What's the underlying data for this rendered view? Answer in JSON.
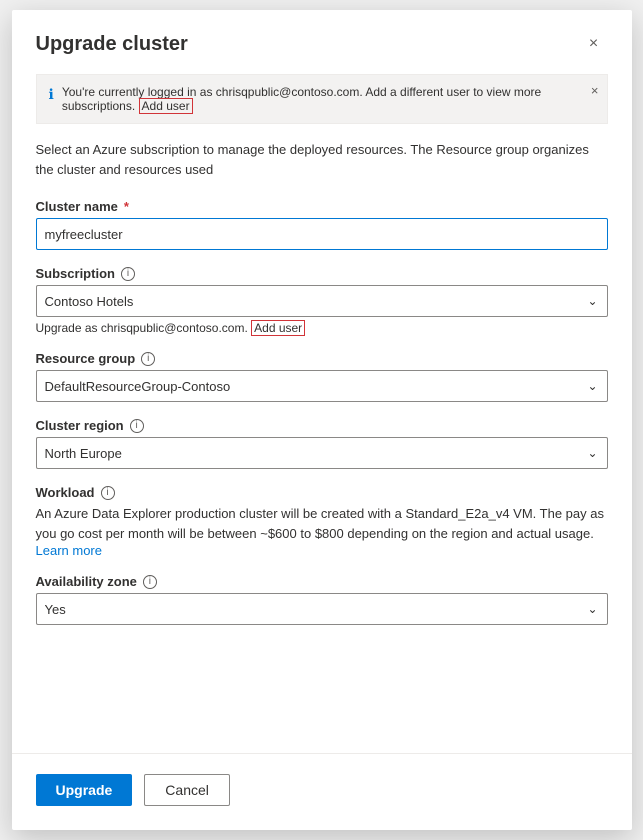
{
  "dialog": {
    "title": "Upgrade cluster",
    "close_label": "×"
  },
  "banner": {
    "text_before": "You're currently logged in as chrisqpublic@contoso.com. Add a different user to view more subscriptions.",
    "add_user_label": "Add user",
    "close_label": "×"
  },
  "description": "Select an Azure subscription to manage the deployed resources. The Resource group organizes the cluster and resources used",
  "form": {
    "cluster_name": {
      "label": "Cluster name",
      "required": "*",
      "value": "myfreecluster",
      "placeholder": ""
    },
    "subscription": {
      "label": "Subscription",
      "value": "Contoso Hotels",
      "note_before": "Upgrade as chrisqpublic@contoso.com.",
      "add_user_label": "Add user"
    },
    "resource_group": {
      "label": "Resource group",
      "value": "DefaultResourceGroup-Contoso"
    },
    "cluster_region": {
      "label": "Cluster region",
      "value": "North Europe"
    },
    "workload": {
      "label": "Workload",
      "description": "An Azure Data Explorer production cluster will be created with a Standard_E2a_v4 VM. The pay as you go cost per month will be between ~$600 to $800 depending on the region and actual usage.",
      "learn_more": "Learn more"
    },
    "availability_zone": {
      "label": "Availability zone",
      "value": "Yes"
    }
  },
  "footer": {
    "upgrade_label": "Upgrade",
    "cancel_label": "Cancel"
  },
  "icons": {
    "info": "ℹ",
    "chevron_down": "∨",
    "close": "✕"
  }
}
